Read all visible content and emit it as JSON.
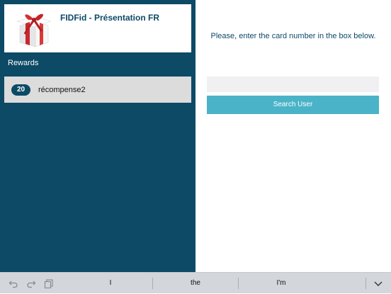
{
  "app": {
    "title": "FIDFid - Présentation FR"
  },
  "sidebar": {
    "section_title": "Rewards",
    "rewards": [
      {
        "points": "20",
        "label": "récompense2"
      }
    ]
  },
  "main": {
    "instruction": "Please, enter the card number in the box below.",
    "card_input": {
      "value": "",
      "placeholder": ""
    },
    "search_button": "Search User"
  },
  "keyboard": {
    "suggestions": [
      "I",
      "the",
      "I'm"
    ],
    "icons": [
      "undo-icon",
      "redo-icon",
      "paste-icon",
      "chevron-down-icon"
    ]
  },
  "colors": {
    "sidebar": "#0d4a66",
    "accent": "#4ab3c8",
    "row": "#dcdcdc"
  }
}
